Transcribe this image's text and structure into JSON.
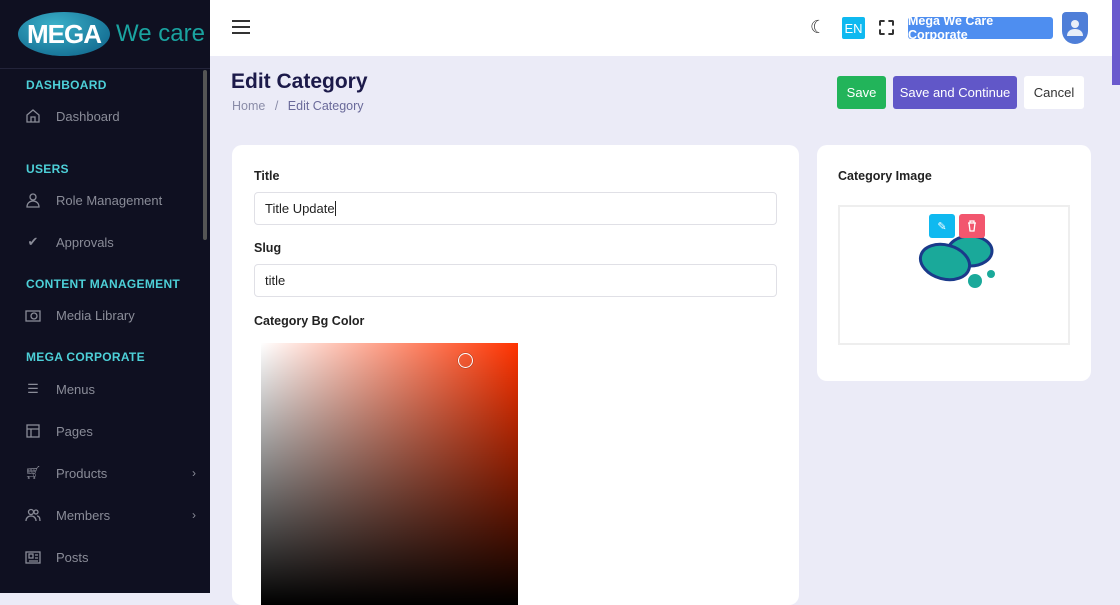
{
  "sidebar": {
    "logo_mark": "MEGA",
    "logo_text": "We care",
    "sections": [
      {
        "label": "DASHBOARD"
      },
      {
        "label": "USERS"
      },
      {
        "label": "CONTENT MANAGEMENT"
      },
      {
        "label": "MEGA CORPORATE"
      }
    ],
    "items": [
      {
        "label": "Dashboard",
        "icon": "home-icon"
      },
      {
        "label": "Role Management",
        "icon": "user-icon"
      },
      {
        "label": "Approvals",
        "icon": "check-icon"
      },
      {
        "label": "Media Library",
        "icon": "camera-icon"
      },
      {
        "label": "Menus",
        "icon": "menu-icon"
      },
      {
        "label": "Pages",
        "icon": "layout-icon"
      },
      {
        "label": "Products",
        "icon": "cart-icon"
      },
      {
        "label": "Members",
        "icon": "users-icon"
      },
      {
        "label": "Posts",
        "icon": "newspaper-icon"
      }
    ]
  },
  "header": {
    "lang": "EN",
    "account": "Mega We Care Corporate"
  },
  "page": {
    "title": "Edit Category",
    "breadcrumb_home": "Home",
    "breadcrumb_sep": "/",
    "breadcrumb_current": "Edit Category",
    "save": "Save",
    "save_continue": "Save and Continue",
    "cancel": "Cancel"
  },
  "form": {
    "title_label": "Title",
    "title_value": "Title Update",
    "slug_label": "Slug",
    "slug_value": "title",
    "color_label": "Category Bg Color",
    "hue_color": "#ff3300"
  },
  "image_card": {
    "label": "Category Image"
  },
  "colors": {
    "accent": "#6a5acd",
    "save": "#22b45a",
    "edit": "#0fb9f0",
    "delete": "#f2566e"
  }
}
